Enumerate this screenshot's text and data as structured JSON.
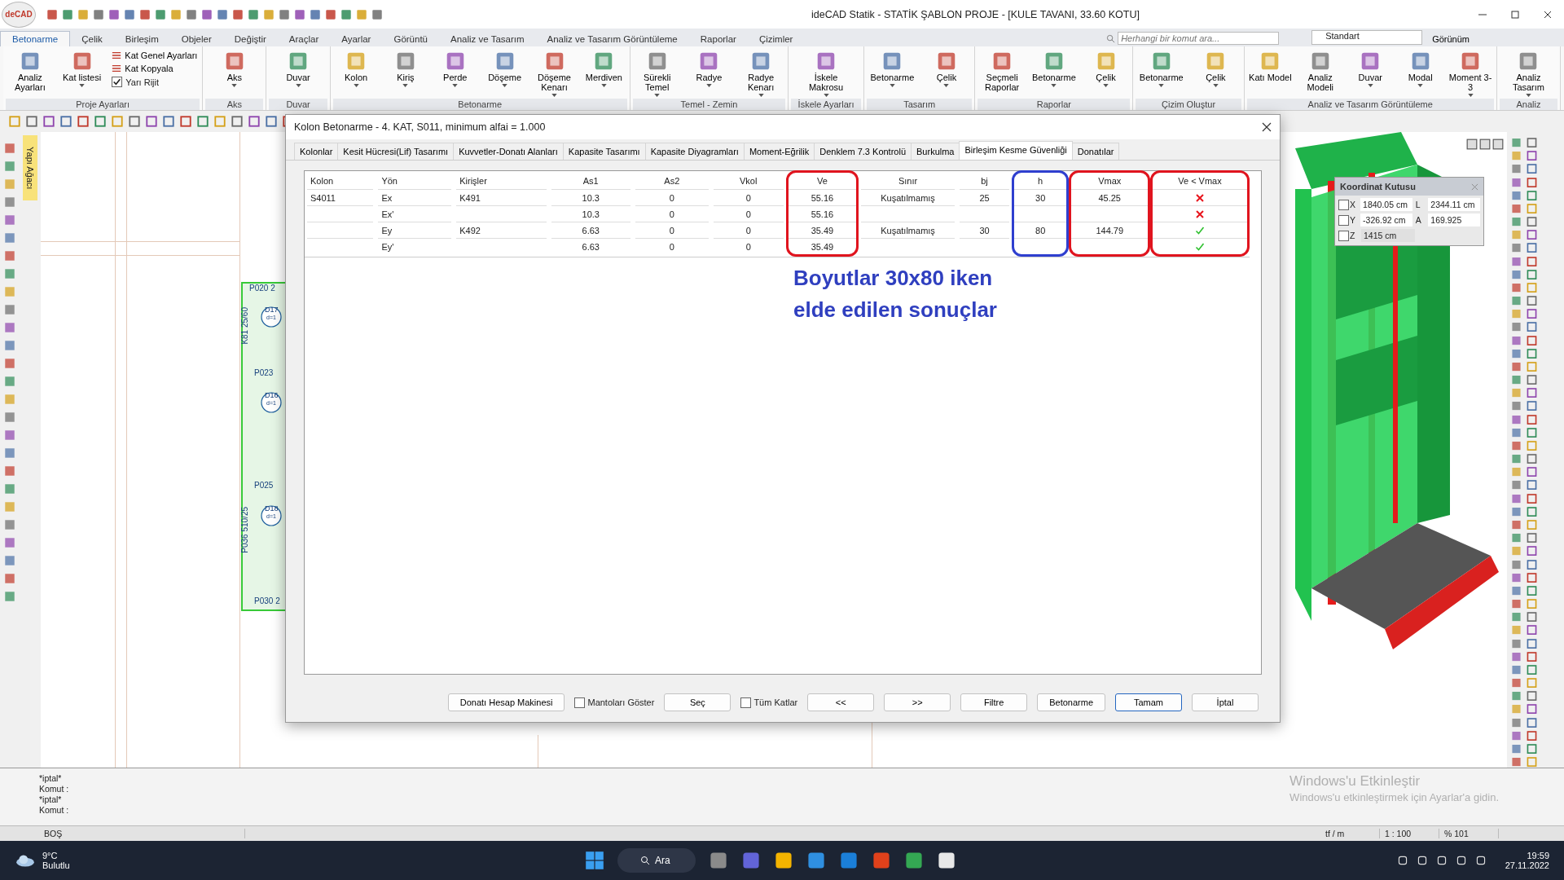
{
  "window": {
    "logo": "deCAD",
    "title": "ideCAD Statik - STATİK ŞABLON PROJE - [KULE TAVANI, 33.60 KOTU]"
  },
  "menu_tabs": [
    {
      "label": "Betonarme",
      "selected": true
    },
    {
      "label": "Çelik",
      "selected": false
    },
    {
      "label": "Birleşim",
      "selected": false
    },
    {
      "label": "Objeler",
      "selected": false
    },
    {
      "label": "Değiştir",
      "selected": false
    },
    {
      "label": "Araçlar",
      "selected": false
    },
    {
      "label": "Ayarlar",
      "selected": false
    },
    {
      "label": "Görüntü",
      "selected": false
    },
    {
      "label": "Analiz ve Tasarım",
      "selected": false
    },
    {
      "label": "Analiz ve Tasarım Görüntüleme",
      "selected": false
    },
    {
      "label": "Raporlar",
      "selected": false
    },
    {
      "label": "Çizimler",
      "selected": false
    }
  ],
  "command_search": {
    "placeholder": "Herhangi bir komut ara..."
  },
  "style_select": {
    "value": "Standart"
  },
  "view_menu": "Görünüm",
  "ribbon_groups": [
    {
      "label": "Proje Ayarları",
      "buttons": [
        {
          "label": "Analiz Ayarları",
          "dropdown": false
        },
        {
          "label": "Kat listesi",
          "dropdown": true
        }
      ],
      "small_items": [
        {
          "label": "Kat Genel Ayarları",
          "kind": "button"
        },
        {
          "label": "Kat Kopyala",
          "kind": "button"
        },
        {
          "label": "Yarı Rijit",
          "kind": "checkbox",
          "checked": true
        }
      ]
    },
    {
      "label": "Aks",
      "buttons": [
        {
          "label": "Aks",
          "dropdown": true
        }
      ]
    },
    {
      "label": "Duvar",
      "buttons": [
        {
          "label": "Duvar",
          "dropdown": true
        }
      ]
    },
    {
      "label": "Betonarme",
      "buttons": [
        {
          "label": "Kolon",
          "dropdown": true
        },
        {
          "label": "Kiriş",
          "dropdown": true
        },
        {
          "label": "Perde",
          "dropdown": true
        },
        {
          "label": "Döşeme",
          "dropdown": true
        },
        {
          "label": "Döşeme Kenarı",
          "dropdown": true
        },
        {
          "label": "Merdiven",
          "dropdown": true
        }
      ]
    },
    {
      "label": "Temel - Zemin",
      "buttons": [
        {
          "label": "Sürekli Temel",
          "dropdown": true
        },
        {
          "label": "Radye",
          "dropdown": true
        },
        {
          "label": "Radye Kenarı",
          "dropdown": true
        }
      ]
    },
    {
      "label": "İskele Ayarları",
      "buttons": [
        {
          "label": "İskele Makrosu",
          "dropdown": true
        }
      ]
    },
    {
      "label": "Tasarım",
      "buttons": [
        {
          "label": "Betonarme",
          "dropdown": true
        },
        {
          "label": "Çelik",
          "dropdown": true
        }
      ]
    },
    {
      "label": "Raporlar",
      "buttons": [
        {
          "label": "Seçmeli Raporlar",
          "dropdown": false
        },
        {
          "label": "Betonarme",
          "dropdown": true
        },
        {
          "label": "Çelik",
          "dropdown": true
        }
      ]
    },
    {
      "label": "Çizim Oluştur",
      "buttons": [
        {
          "label": "Betonarme",
          "dropdown": true
        },
        {
          "label": "Çelik",
          "dropdown": true
        }
      ]
    },
    {
      "label": "Analiz ve Tasarım Görüntüleme",
      "buttons": [
        {
          "label": "Katı Model",
          "dropdown": false
        },
        {
          "label": "Analiz Modeli",
          "dropdown": false
        },
        {
          "label": "Duvar",
          "dropdown": true
        },
        {
          "label": "Modal",
          "dropdown": true
        },
        {
          "label": "Moment 3-3",
          "dropdown": true
        }
      ]
    },
    {
      "label": "Analiz",
      "buttons": [
        {
          "label": "Analiz Tasarım",
          "dropdown": true
        }
      ]
    }
  ],
  "side_panel": {
    "tab": "Yapı Ağacı"
  },
  "plan_labels": [
    "P020 2",
    "K81 25/60",
    "D17",
    "d=1",
    "P023",
    "D16",
    "d=1",
    "P025",
    "D18",
    "d=1",
    "P036 510/25",
    "P030 2"
  ],
  "dialog": {
    "title": "Kolon Betonarme - 4. KAT, S011, minimum alfai = 1.000",
    "tabs": [
      {
        "label": "Kolonlar",
        "selected": false
      },
      {
        "label": "Kesit Hücresi(Lif) Tasarımı",
        "selected": false
      },
      {
        "label": "Kuvvetler-Donatı Alanları",
        "selected": false
      },
      {
        "label": "Kapasite Tasarımı",
        "selected": false
      },
      {
        "label": "Kapasite Diyagramları",
        "selected": false
      },
      {
        "label": "Moment-Eğrilik",
        "selected": false
      },
      {
        "label": "Denklem 7.3 Kontrolü",
        "selected": false
      },
      {
        "label": "Burkulma",
        "selected": false
      },
      {
        "label": "Birleşim Kesme Güvenliği",
        "selected": true
      },
      {
        "label": "Donatılar",
        "selected": false
      }
    ],
    "columns": [
      {
        "label": "Kolon",
        "kind": "value"
      },
      {
        "label": "Yön",
        "kind": "value"
      },
      {
        "label": "Kirişler",
        "kind": "value"
      },
      {
        "label": "As1",
        "kind": "value"
      },
      {
        "label": "As2",
        "kind": "value"
      },
      {
        "label": "Vkol",
        "kind": "value"
      },
      {
        "label": "Ve",
        "kind": "value",
        "color": "#e0141e"
      },
      {
        "label": "Sınır",
        "kind": "value"
      },
      {
        "label": "bj",
        "kind": "value"
      },
      {
        "label": "h",
        "kind": "value",
        "color": "#2f3fcf"
      },
      {
        "label": "Vmax",
        "kind": "value",
        "color": "#e0141e"
      },
      {
        "label": "Ve < Vmax",
        "kind": "check",
        "color": "#e0141e"
      }
    ],
    "rows": [
      {
        "cells": [
          "S4011",
          "Ex",
          "K491",
          "10.3",
          "0",
          "0",
          "55.16",
          "Kuşatılmamış",
          "25",
          "30",
          "45.25"
        ],
        "pass": false
      },
      {
        "cells": [
          null,
          "Ex'",
          null,
          "10.3",
          "0",
          "0",
          "55.16",
          null,
          null,
          null,
          null
        ],
        "pass": false
      },
      {
        "cells": [
          null,
          "Ey",
          "K492",
          "6.63",
          "0",
          "0",
          "35.49",
          "Kuşatılmamış",
          "30",
          "80",
          "144.79"
        ],
        "pass": true
      },
      {
        "cells": [
          null,
          "Ey'",
          null,
          "6.63",
          "0",
          "0",
          "35.49",
          null,
          null,
          null,
          null
        ],
        "pass": true
      }
    ],
    "annotation": [
      "Boyutlar 30x80 iken",
      "elde edilen sonuçlar"
    ],
    "footer": [
      {
        "kind": "button",
        "label": "Donatı Hesap Makinesi"
      },
      {
        "kind": "checkbox",
        "label": "Mantoları Göster",
        "checked": false
      },
      {
        "kind": "button",
        "label": "Seç"
      },
      {
        "kind": "checkbox",
        "label": "Tüm Katlar",
        "checked": false
      },
      {
        "kind": "button",
        "label": "<<"
      },
      {
        "kind": "button",
        "label": ">>"
      },
      {
        "kind": "button",
        "label": "Filtre"
      },
      {
        "kind": "button",
        "label": "Betonarme"
      },
      {
        "kind": "button",
        "label": "Tamam",
        "selected": true
      },
      {
        "kind": "button",
        "label": "İptal"
      }
    ]
  },
  "coordinate_box": {
    "title": "Koordinat Kutusu",
    "fields": [
      {
        "axis": "X",
        "value": "1840.05 cm",
        "checked": false,
        "extra_label": "L",
        "extra_value": "2344.11 cm"
      },
      {
        "axis": "Y",
        "value": "-326.92 cm",
        "checked": false,
        "extra_label": "A",
        "extra_value": "169.925"
      },
      {
        "axis": "Z",
        "value": "1415 cm",
        "checked": false
      }
    ]
  },
  "command_log": [
    "*iptal*",
    "Komut :",
    "*iptal*",
    "Komut :"
  ],
  "activation_notice": {
    "title": "Windows'u Etkinleştir",
    "text": "Windows'u etkinleştirmek için Ayarlar'a gidin."
  },
  "status_bar": [
    "BOŞ",
    "tf / m",
    "1 : 100",
    "% 101"
  ],
  "taskbar": {
    "temperature": "9°C",
    "condition": "Bulutlu",
    "search": "Ara",
    "time": "19:59",
    "date": "27.11.2022"
  }
}
